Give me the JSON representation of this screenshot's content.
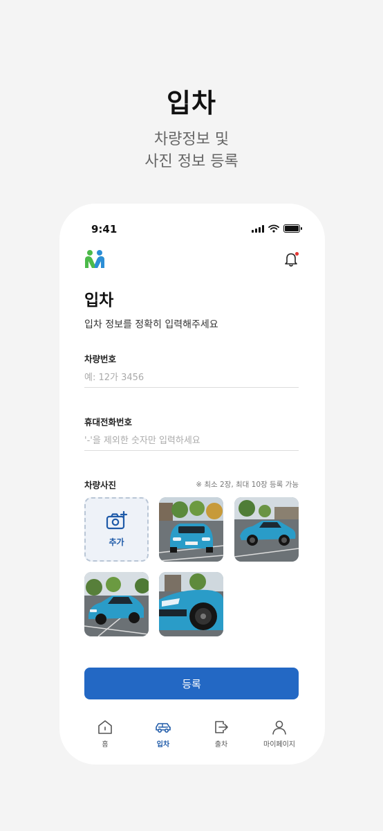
{
  "promo": {
    "title": "입차",
    "subtitle_line1": "차량정보 및",
    "subtitle_line2": "사진 정보 등록"
  },
  "status_bar": {
    "time": "9:41"
  },
  "header": {
    "logo_icon": "people-logo-icon",
    "notification_icon": "bell-icon",
    "has_unread_dot": true
  },
  "page": {
    "title": "입차",
    "description": "입차 정보를 정확히 입력해주세요"
  },
  "form": {
    "car_number": {
      "label": "차량번호",
      "placeholder": "예: 12가 3456",
      "value": ""
    },
    "phone": {
      "label": "휴대전화번호",
      "placeholder": "'-'을 제외한 숫자만 입력하세요",
      "value": ""
    }
  },
  "photos": {
    "label": "차량사진",
    "note": "※ 최소 2장, 최대 10장 등록 가능",
    "add_label": "추가",
    "items": [
      {
        "name": "car-photo-front",
        "body_color": "#2a9cc8"
      },
      {
        "name": "car-photo-side",
        "body_color": "#2a9cc8"
      },
      {
        "name": "car-photo-front-quarter",
        "body_color": "#2a9cc8"
      },
      {
        "name": "car-photo-closeup",
        "body_color": "#2a9cc8"
      }
    ]
  },
  "submit_label": "등록",
  "tabs": [
    {
      "label": "홈",
      "icon": "home-icon",
      "active": false
    },
    {
      "label": "입차",
      "icon": "car-icon",
      "active": true
    },
    {
      "label": "출차",
      "icon": "exit-icon",
      "active": false
    },
    {
      "label": "마이페이지",
      "icon": "user-icon",
      "active": false
    }
  ],
  "colors": {
    "accent": "#2368c4",
    "logo_green": "#4cba4a",
    "logo_blue": "#2c8ed6",
    "alert_red": "#e53935"
  }
}
